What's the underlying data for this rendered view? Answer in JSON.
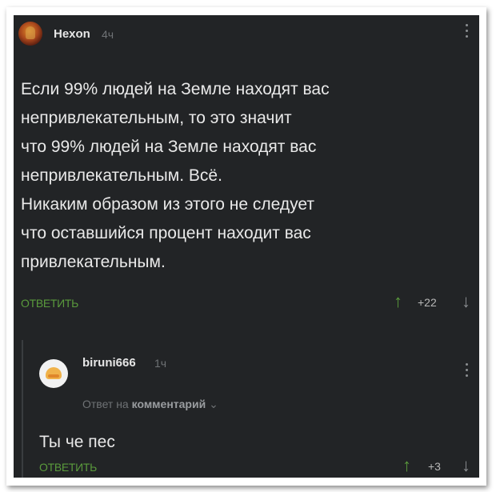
{
  "comment": {
    "username": "Hexon",
    "time": "4ч",
    "text_lines": [
      "Если 99% людей на Земле находят вас",
      "непривлекательным, то это значит",
      "что 99% людей на Земле находят вас",
      "непривлекательным. Всё.",
      "Никаким образом из этого не следует",
      "что оставшийся процент находит вас",
      "привлекательным."
    ],
    "reply_label": "ОТВЕТИТЬ",
    "score": "+22"
  },
  "reply": {
    "username": "biruni666",
    "time": "1ч",
    "reply_to_prefix": "Ответ на",
    "reply_to_target": "комментарий",
    "text": "Ты че пес",
    "reply_label": "ОТВЕТИТЬ",
    "score": "+3"
  },
  "colors": {
    "background": "#222426",
    "accent_green": "#5a9a3c",
    "text": "#e9e9e9",
    "muted": "#6f7275"
  },
  "icons": {
    "upvote": "arrow-up-icon",
    "downvote": "arrow-down-icon",
    "more": "kebab-menu-icon",
    "expand": "chevron-down-icon"
  }
}
